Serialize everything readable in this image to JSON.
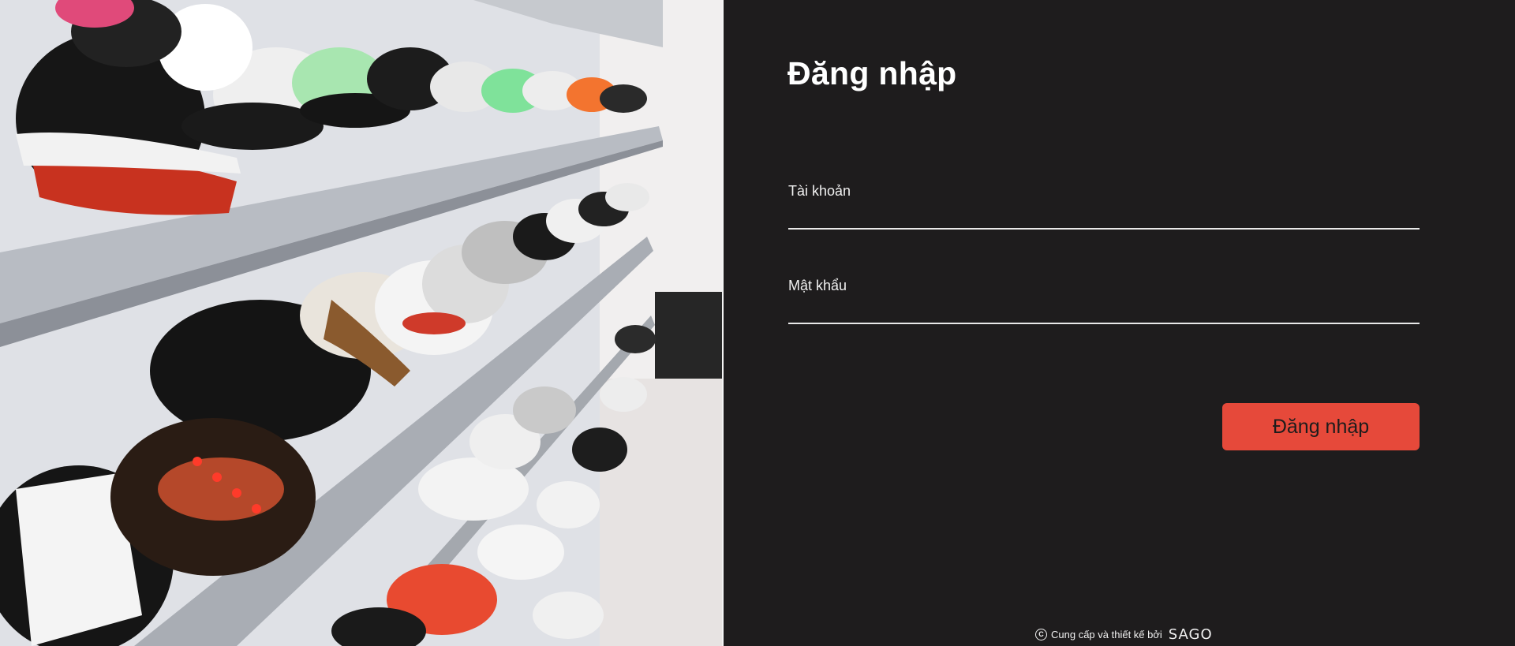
{
  "hero": {
    "image_name": "sneaker-shelf-photo"
  },
  "login": {
    "title": "Đăng nhập",
    "username_label": "Tài khoản",
    "username_value": "",
    "password_label": "Mật khẩu",
    "password_value": "",
    "submit_label": "Đăng nhập"
  },
  "footer": {
    "text": "Cung cấp và thiết kế bởi",
    "brand": "SAGO",
    "icon": "copyright-icon"
  },
  "colors": {
    "background": "#1e1c1d",
    "accent": "#e6493a",
    "text": "#ffffff"
  }
}
